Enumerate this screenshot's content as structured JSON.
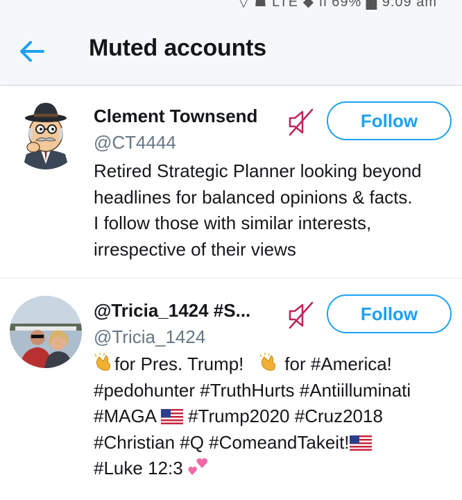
{
  "status_bar": {
    "clipped_text": "▽ ☗ LTE ◆ ıl  69%  ▇ 9:09 am"
  },
  "header": {
    "title": "Muted accounts",
    "back_icon": "arrow-left-icon"
  },
  "colors": {
    "accent": "#1da1f2",
    "mute_icon": "#c0245c",
    "secondary_text": "#657786"
  },
  "accounts": [
    {
      "name": "Clement Townsend",
      "handle": "@CT4444",
      "bio_lines": [
        "Retired Strategic Planner looking beyond",
        "headlines for balanced opinions & facts.",
        "I follow those with similar interests,",
        "irrespective of their views"
      ],
      "follow_label": "Follow",
      "muted": true
    },
    {
      "name": "@Tricia_1424  #S...",
      "handle": "@Tricia_1424",
      "bio": {
        "l1_a": "for Pres. Trump!",
        "l1_b": "for #America!",
        "l2": "#pedohunter #TruthHurts #Antiilluminati",
        "l3_a": "#MAGA",
        "l3_b": "#Trump2020 #Cruz2018",
        "l4": "#Christian #Q #ComeandTakeit!",
        "l5": "#Luke 12:3"
      },
      "emojis": [
        "clapping-hands",
        "clapping-hands",
        "us-flag",
        "us-flag",
        "two-hearts"
      ],
      "follow_label": "Follow",
      "muted": true
    }
  ]
}
